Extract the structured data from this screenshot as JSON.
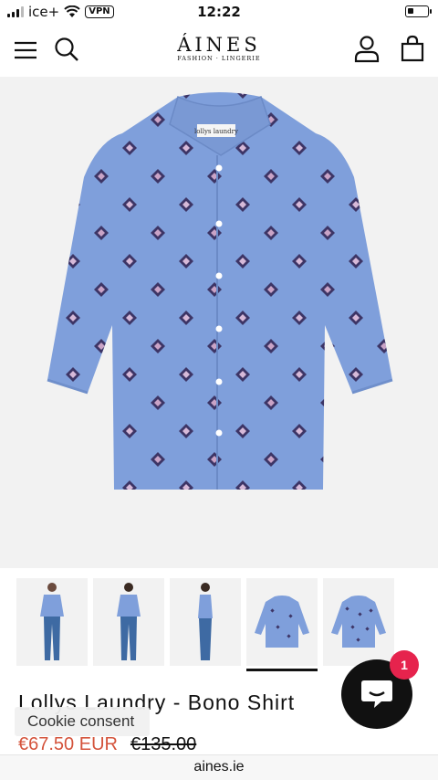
{
  "status_bar": {
    "carrier": "ice+",
    "vpn": "VPN",
    "time": "12:22"
  },
  "header": {
    "logo": "ÁINES",
    "tagline": "FASHION · LINGERIE",
    "icons": [
      "menu-icon",
      "search-icon",
      "account-icon",
      "cart-icon"
    ]
  },
  "product": {
    "image_alt": "Blue shirt with diamond pattern",
    "shirt_label": "lollys laundry",
    "thumbnails": [
      {
        "name": "front-model"
      },
      {
        "name": "back-model"
      },
      {
        "name": "side-model"
      },
      {
        "name": "flat-front",
        "active": true
      },
      {
        "name": "flat-back"
      }
    ],
    "title": "Lollys Laundry - Bono Shirt",
    "price_sale": "€67.50 EUR",
    "price_original": "€135.00"
  },
  "cookie": {
    "label": "Cookie consent"
  },
  "chat": {
    "badge_count": "1"
  },
  "browser": {
    "url": "aines.ie"
  },
  "colors": {
    "accent_sale": "#d4533b",
    "badge": "#e6234d",
    "shirt": "#7f9fdb"
  }
}
